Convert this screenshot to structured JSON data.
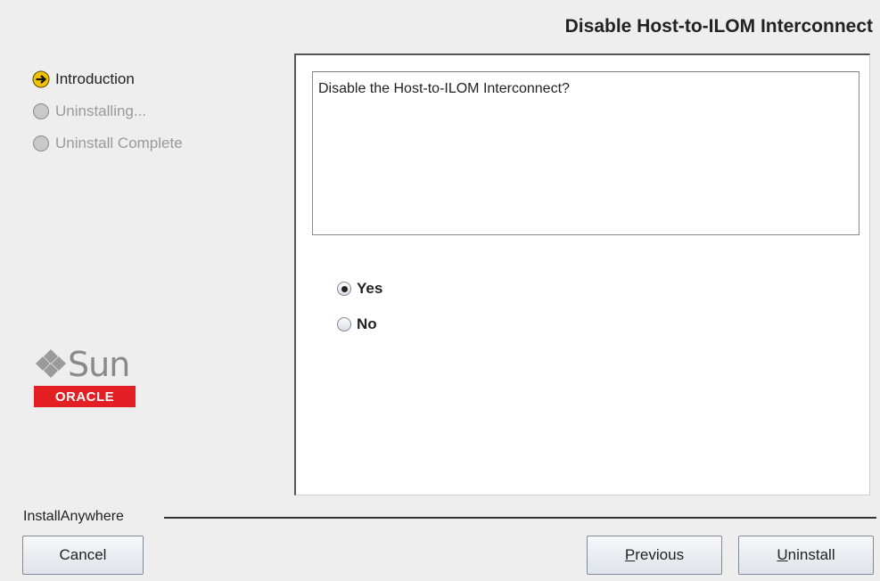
{
  "header": {
    "title": "Disable Host-to-ILOM Interconnect"
  },
  "steps": [
    {
      "label": "Introduction",
      "state": "active",
      "icon": "arrow-right-circle-icon"
    },
    {
      "label": "Uninstalling...",
      "state": "pending",
      "icon": "circle-icon"
    },
    {
      "label": "Uninstall Complete",
      "state": "pending",
      "icon": "circle-icon"
    }
  ],
  "logo": {
    "sun": "Sun",
    "oracle": "ORACLE"
  },
  "main": {
    "question": "Disable the Host-to-ILOM Interconnect?",
    "options": [
      {
        "label": "Yes",
        "selected": true
      },
      {
        "label": "No",
        "selected": false
      }
    ]
  },
  "footer": {
    "brand": "InstallAnywhere",
    "cancel_label": "Cancel",
    "previous_mnemonic": "P",
    "previous_rest": "revious",
    "uninstall_mnemonic": "U",
    "uninstall_rest": "ninstall"
  },
  "colors": {
    "accent": "#f2c200",
    "oracle_red": "#e41f24",
    "background": "#eeeeee"
  }
}
